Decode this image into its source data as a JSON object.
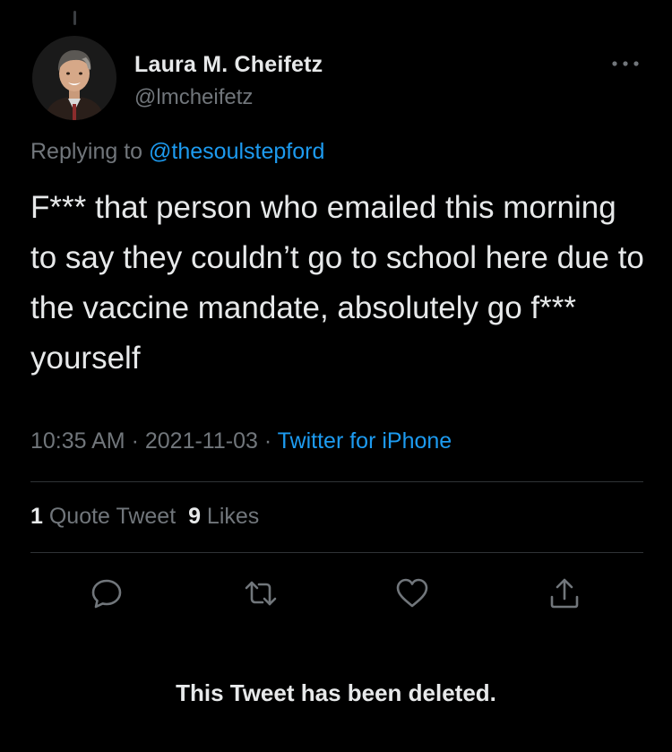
{
  "author": {
    "display_name": "Laura M. Cheifetz",
    "handle": "@lmcheifetz",
    "avatar_icon": "profile-photo"
  },
  "reply": {
    "prefix": "Replying to ",
    "mention": "@thesoulstepford"
  },
  "tweet": {
    "text": "F*** that person who emailed this morning to say they couldn’t go to school here due to the vaccine mandate, absolutely go f*** yourself",
    "time": "10:35 AM",
    "date": "2021-11-03",
    "separator": " · ",
    "source": "Twitter for iPhone"
  },
  "stats": {
    "quote_count": "1",
    "quote_label": " Quote Tweet",
    "like_count": "9",
    "like_label": " Likes"
  },
  "actions": [
    {
      "name": "reply",
      "icon": "speech-bubble-icon"
    },
    {
      "name": "retweet",
      "icon": "retweet-arrows-icon"
    },
    {
      "name": "like",
      "icon": "heart-icon"
    },
    {
      "name": "share",
      "icon": "share-upload-icon"
    }
  ],
  "notice": "This Tweet has been deleted.",
  "colors": {
    "background": "#000000",
    "text": "#e7e9ea",
    "muted": "#71767b",
    "link": "#1d9bf0",
    "divider": "#2f3336"
  }
}
